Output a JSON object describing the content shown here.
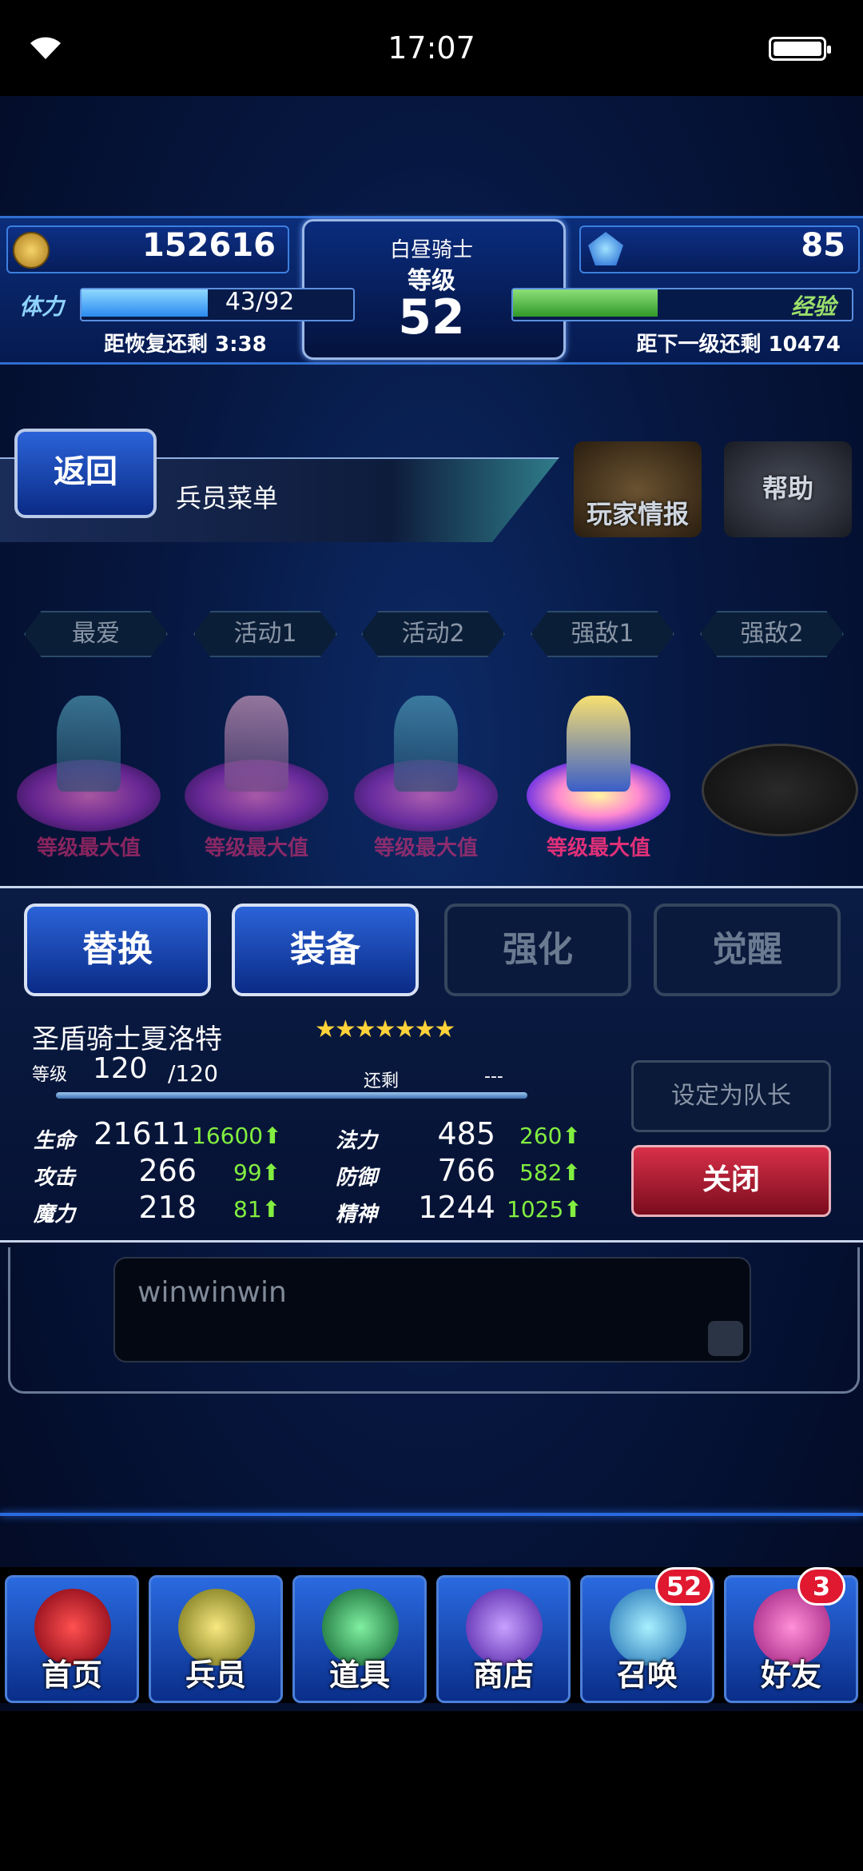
{
  "status_bar": {
    "time": "17:07"
  },
  "header": {
    "gold": "152616",
    "gems": "85",
    "title": "白昼骑士",
    "level_label": "等级",
    "level": "52",
    "stamina_label": "体力",
    "stamina_current": "43",
    "stamina_max": "/92",
    "stamina_fraction": 0.47,
    "recover_text": "距恢复还剩 3:38",
    "exp_label": "经验",
    "exp_fraction": 0.43,
    "next_level_text": "距下一级还剩 10474"
  },
  "nav": {
    "back_label": "返回",
    "menu_title": "兵员菜单",
    "player_info_label": "玩家情报",
    "help_label": "帮助"
  },
  "tabs": [
    "最爱",
    "活动1",
    "活动2",
    "强敌1",
    "强敌2"
  ],
  "units": [
    {
      "label": "等级最大值"
    },
    {
      "label": "等级最大值"
    },
    {
      "label": "等级最大值"
    },
    {
      "label": "等级最大值"
    }
  ],
  "actions": {
    "swap": "替换",
    "equip": "装备",
    "enhance": "强化",
    "awaken": "觉醒"
  },
  "character": {
    "name": "圣盾骑士夏洛特",
    "stars": "★★★★★★★",
    "level_label": "等级",
    "level": "120",
    "level_max": "/120",
    "remain_label": "还剩",
    "remain_value": "---",
    "stats": [
      {
        "label": "生命",
        "value": "21611",
        "bonus": "16600"
      },
      {
        "label": "法力",
        "value": "485",
        "bonus": "260"
      },
      {
        "label": "攻击",
        "value": "266",
        "bonus": "99"
      },
      {
        "label": "防御",
        "value": "766",
        "bonus": "582"
      },
      {
        "label": "魔力",
        "value": "218",
        "bonus": "81"
      },
      {
        "label": "精神",
        "value": "1244",
        "bonus": "1025"
      }
    ],
    "set_leader_label": "设定为队长",
    "close_label": "关闭"
  },
  "comment": {
    "text": "winwinwin"
  },
  "bottom_nav": [
    {
      "label": "首页",
      "icon": "home-sword-icon"
    },
    {
      "label": "兵员",
      "icon": "units-icon"
    },
    {
      "label": "道具",
      "icon": "potion-icon"
    },
    {
      "label": "商店",
      "icon": "shop-icon"
    },
    {
      "label": "召唤",
      "icon": "summon-crystal-icon",
      "badge": "52"
    },
    {
      "label": "好友",
      "icon": "friends-icon",
      "badge": "3"
    }
  ],
  "colors": {
    "accent": "#2a6ae0",
    "close": "#d8304a",
    "bonus": "#82ee40",
    "max_label": "#e03078"
  }
}
